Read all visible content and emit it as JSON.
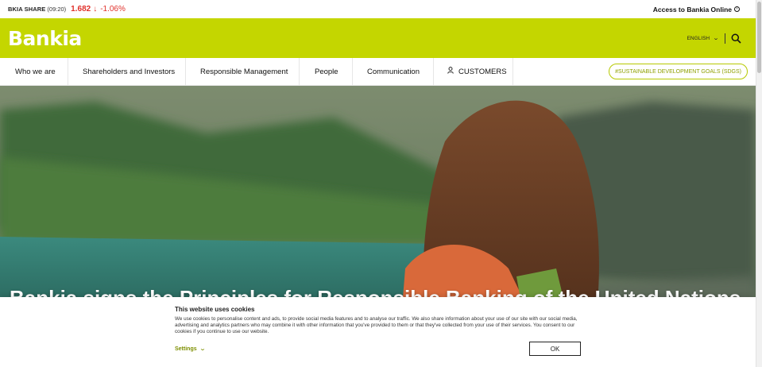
{
  "ticker": {
    "label": "BKIA SHARE",
    "time": "(09:20)",
    "price": "1.682",
    "arrow": "↓",
    "change": "-1.06%"
  },
  "online_access": {
    "label": "Access to Bankia Online",
    "icon": "external-link-icon"
  },
  "header": {
    "logo": "Bankia",
    "language": "ENGLISH",
    "brand_color": "#c4d600"
  },
  "nav": {
    "items": [
      {
        "label": "Who we are"
      },
      {
        "label": "Shareholders and Investors"
      },
      {
        "label": "Responsible Management"
      },
      {
        "label": "People"
      },
      {
        "label": "Communication"
      },
      {
        "label": "CUSTOMERS",
        "icon": "user-icon"
      }
    ],
    "sdg_label": "#SUSTAINABLE DEVELOPMENT GOALS (SDGS)"
  },
  "hero": {
    "title": "Bankia signs the Principles for Responsible Banking of the United Nations"
  },
  "cookie": {
    "title": "This website uses cookies",
    "text": "We use cookies to personalise content and ads, to provide social media features and to analyse our traffic. We also share information about your use of our site with our social media, advertising and analytics partners who may combine it with other information that you've provided to them or that they've collected from your use of their services. You consent to our cookies if you continue to use our website.",
    "settings_label": "Settings",
    "ok_label": "OK"
  }
}
